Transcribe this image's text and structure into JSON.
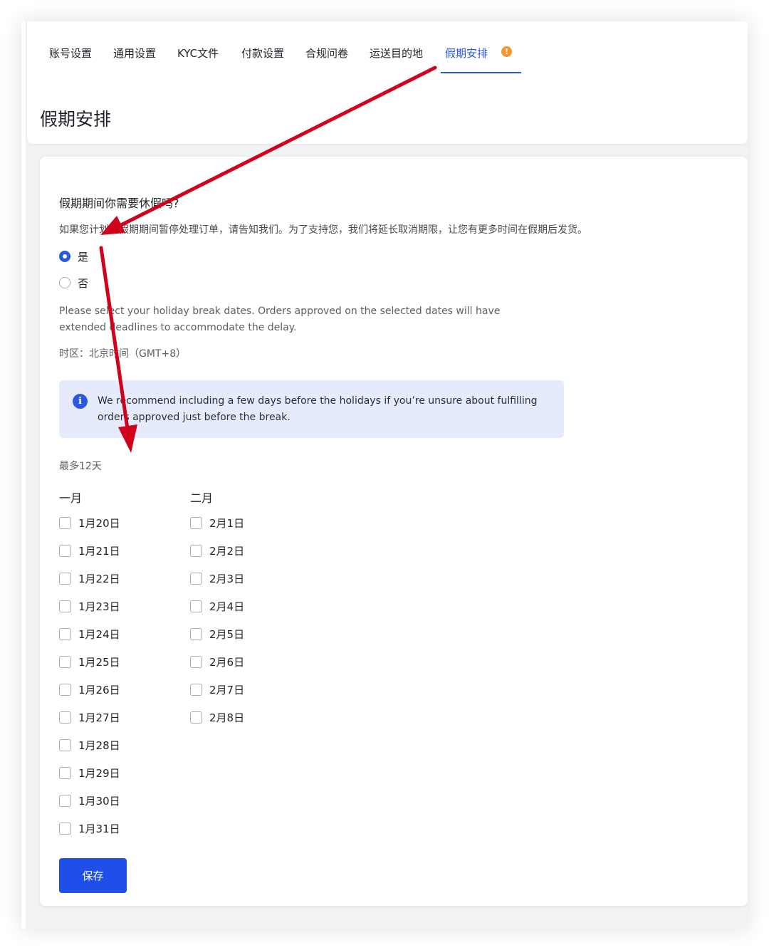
{
  "tabs": [
    {
      "label": "账号设置"
    },
    {
      "label": "通用设置"
    },
    {
      "label": "KYC文件"
    },
    {
      "label": "付款设置"
    },
    {
      "label": "合规问卷"
    },
    {
      "label": "运送目的地"
    },
    {
      "label": "假期安排",
      "active": true,
      "alert": "!"
    }
  ],
  "page_title": "假期安排",
  "question": {
    "title": "假期期间你需要休假吗?",
    "description": "如果您计划在假期期间暂停处理订单，请告知我们。为了支持您，我们将延长取消期限，让您有更多时间在假期后发货。",
    "options": [
      {
        "label": "是",
        "checked": true
      },
      {
        "label": "否",
        "checked": false
      }
    ]
  },
  "hint_en": "Please select your holiday break dates. Orders approved on the selected dates will have extended deadlines to accommodate the delay.",
  "timezone": "时区：北京时间（GMT+8）",
  "info_banner": {
    "icon": "info-icon",
    "text": "We recommend including a few days before the holidays if you’re unsure about fulfilling orders approved just before the break."
  },
  "max_days": "最多12天",
  "months": [
    {
      "name": "一月",
      "dates": [
        "1月20日",
        "1月21日",
        "1月22日",
        "1月23日",
        "1月24日",
        "1月25日",
        "1月26日",
        "1月27日",
        "1月28日",
        "1月29日",
        "1月30日",
        "1月31日"
      ]
    },
    {
      "name": "二月",
      "dates": [
        "2月1日",
        "2月2日",
        "2月3日",
        "2月4日",
        "2月5日",
        "2月6日",
        "2月7日",
        "2月8日"
      ]
    }
  ],
  "save_label": "保存",
  "colors": {
    "accent": "#2a57e0",
    "button": "#1f4fe8",
    "alert": "#f0962d",
    "annotation_arrow": "#d0021b",
    "banner_bg": "#e6ebfb"
  }
}
